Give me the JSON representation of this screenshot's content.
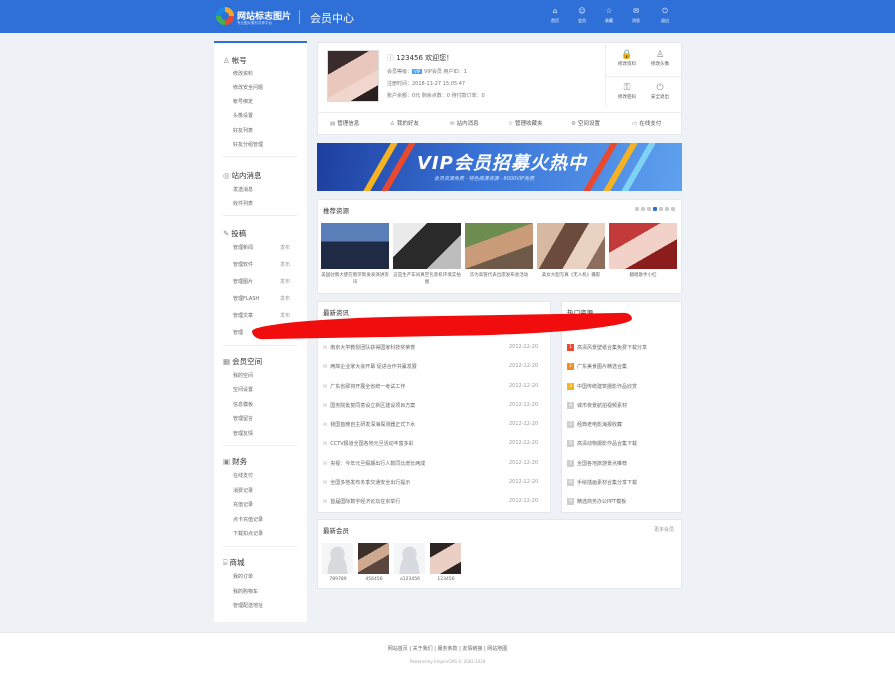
{
  "header": {
    "site_title": "网站标志图片",
    "site_subtitle": "专业图片素材共享平台",
    "page_title": "会员中心",
    "nav": [
      {
        "label": "首页",
        "icon": "home-icon"
      },
      {
        "label": "会员",
        "icon": "user-icon"
      },
      {
        "label": "收藏",
        "icon": "star-icon"
      },
      {
        "label": "消息",
        "icon": "mail-icon"
      },
      {
        "label": "退出",
        "icon": "power-icon"
      }
    ]
  },
  "sidebar": {
    "account": {
      "title": "帐号",
      "icon": "user-icon",
      "items": [
        "修改资料",
        "修改安全问题",
        "帐号绑定",
        "头像设置",
        "好友列表",
        "好友分组管理"
      ]
    },
    "messages": {
      "title": "站内消息",
      "icon": "message-icon",
      "items": [
        "发送消息",
        "收件列表"
      ]
    },
    "publish": {
      "title": "投稿",
      "icon": "edit-icon",
      "items": [
        {
          "label": "管理新闻",
          "tag": "发布"
        },
        {
          "label": "管理软件",
          "tag": "发布"
        },
        {
          "label": "管理图片",
          "tag": "发布"
        },
        {
          "label": "管理FLASH",
          "tag": "发布"
        },
        {
          "label": "管理文章",
          "tag": "发布"
        },
        {
          "label": "管理",
          "tag": ""
        }
      ]
    },
    "space": {
      "title": "会员空间",
      "icon": "space-icon",
      "items": [
        "我的空间",
        "空间设置",
        "信息模板",
        "管理留言",
        "管理友情"
      ]
    },
    "finance": {
      "title": "财务",
      "icon": "finance-icon",
      "items": [
        "在线支付",
        "消费记录",
        "充值记录",
        "点卡充值记录",
        "下载扣点记录"
      ]
    },
    "mall": {
      "title": "商城",
      "icon": "shop-icon",
      "items": [
        "我的订单",
        "我的购物车",
        "管理配送地址"
      ]
    }
  },
  "profile": {
    "greeting": "123456 欢迎您！",
    "level_label": "会员等级：",
    "level_value": "VIP会员 用户ID：1",
    "vip_badge": "VIP",
    "reg_time": "注册时间：2018-11-27 15:05:47",
    "stats": "账户余额：0元 剩余点数：0 待付款订单：0",
    "quick": [
      {
        "label": "修改资料",
        "icon": "lock-icon"
      },
      {
        "label": "修改头像",
        "icon": "user-icon"
      },
      {
        "label": "修改密码",
        "icon": "key-icon"
      },
      {
        "label": "安全退出",
        "icon": "power-icon"
      }
    ],
    "actions": [
      {
        "label": "管理信息",
        "icon": "doc-icon"
      },
      {
        "label": "我的好友",
        "icon": "user-icon"
      },
      {
        "label": "站内消息",
        "icon": "mail-icon"
      },
      {
        "label": "管理收藏夹",
        "icon": "star-icon"
      },
      {
        "label": "空间设置",
        "icon": "gear-icon"
      },
      {
        "label": "在线支付",
        "icon": "wallet-icon"
      }
    ]
  },
  "banner": {
    "title": "VIP会员招募火热中",
    "subtitle": "会员资源免费 · 特色高清资源 · 8000VIP免费"
  },
  "recommend": {
    "title": "推荐资源",
    "items": [
      "美国驻俄大使在俄罗斯发表演讲资讯",
      "这是生产车间真空包装机环境实拍图",
      "华为高管代表出席发布会活动",
      "美女大胆写真《无人机》摄影",
      "翻唱歌手小红"
    ]
  },
  "news": {
    "title": "最新资讯",
    "rows": [
      {
        "text": "南京大学教授团队获得国家科技奖荣誉",
        "date": "2012-12-20"
      },
      {
        "text": "两岸企业家大会开幕 促进合作共赢发展",
        "date": "2012-12-20"
      },
      {
        "text": "广东省即将开展全省统一考试工作",
        "date": "2012-12-20"
      },
      {
        "text": "国务院批复同意设立新区建设项目方案",
        "date": "2012-12-20"
      },
      {
        "text": "我国首艘自主研发深海探测器正式下水",
        "date": "2012-12-20"
      },
      {
        "text": "CCTV报道全国各地元旦活动丰富多彩",
        "date": "2012-12-20"
      },
      {
        "text": "央视：今年元旦假期出行人数同比增长两成",
        "date": "2012-12-20"
      },
      {
        "text": "全国多地发布冬季交通安全出行提示",
        "date": "2012-12-20"
      },
      {
        "text": "首届国际数字经济论坛在京举行",
        "date": "2012-12-20"
      }
    ]
  },
  "hot": {
    "title": "热门资源",
    "rows": [
      "高清风景壁纸合集免费下载分享",
      "广东美食图片精选合集",
      "中国传统建筑摄影作品欣赏",
      "城市夜景航拍视频素材",
      "经典老电影海报收藏",
      "高清动物摄影作品合集下载",
      "全国各地旅游景点推荐",
      "手绘插画素材合集分享下载",
      "精选商务办公PPT模板"
    ],
    "rank_colors": [
      "#e8492f",
      "#f08a24",
      "#f5b323",
      "#cfcfcf",
      "#cfcfcf",
      "#cfcfcf",
      "#cfcfcf",
      "#cfcfcf",
      "#cfcfcf"
    ]
  },
  "visitors": {
    "title": "最新会员",
    "more": "更多会员",
    "items": [
      "789789",
      "456456",
      "a123456",
      "123456"
    ]
  },
  "footer": {
    "links": "网站首页 | 关于我们 | 服务条款 | 友情链接 | 网站地图",
    "copyright": "Powered by EmpireCMS © 2002-2018"
  }
}
